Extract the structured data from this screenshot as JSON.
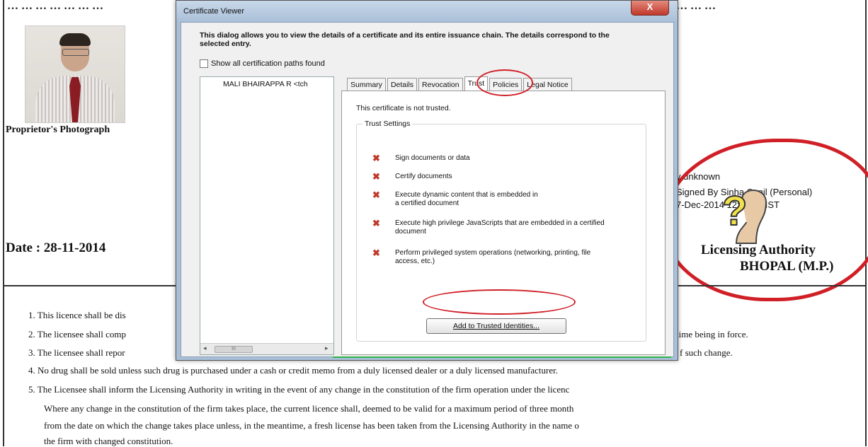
{
  "background_doc": {
    "top_text_left": "… … … … … … …",
    "top_text_right": "… … …",
    "photo_caption": "Proprietor's Photograph",
    "date": "Date : 28-11-2014",
    "signature": {
      "validity": "y unknown",
      "signed_by": "Signed By Sinha Sunil  (Personal)",
      "timestamp": "7-Dec-2014 12:52:05 IST"
    },
    "authority_line1": "Licensing Authority",
    "authority_line2": "BHOPAL (M.P.)",
    "conditions": [
      "1. This licence shall be dis",
      "2. The licensee shall comp",
      "3. The licensee shall repor",
      "4. No drug shall be sold unless such drug is purchased under a cash or credit memo from a duly licensed dealer or a duly licensed manufacturer.",
      "5. The Licensee shall inform the Licensing Authority in writing in the event of any change in the constitution of the firm operation under the licenc"
    ],
    "condition_continuations": [
      "Where any change in the constitution of the firm takes place, the current licence shall, deemed to be valid for a maximum period of three month",
      "from the date on which the change takes place unless, in the meantime, a fresh license has been taken from the Licensing Authority in the name o",
      "the firm with changed constitution."
    ],
    "cond2_tail": "time being in force.",
    "cond3_tail": "f such change.",
    "accent_red": "#d01f26"
  },
  "dialog": {
    "title": "Certificate Viewer",
    "close_label": "X",
    "intro": "This dialog allows you to view the details of a certificate and its entire issuance chain. The details correspond to the selected entry.",
    "show_paths_label": "Show all certification paths found",
    "tree_item": "MALI BHAIRAPPA R <tch",
    "scroll_left": "◂",
    "scroll_thumb": "III",
    "scroll_right": "▸",
    "tabs": [
      "Summary",
      "Details",
      "Revocation",
      "Trust",
      "Policies",
      "Legal Notice"
    ],
    "active_tab": "Trust",
    "trust_status": "This certificate is not trusted.",
    "trust_settings_label": "Trust Settings",
    "permissions": [
      "Sign documents or data",
      "Certify documents",
      "Execute dynamic content that is embedded in a certified document",
      "Execute high privilege JavaScripts that are embedded in a certified document",
      "Perform privileged system operations (networking, printing, file access, etc.)"
    ],
    "deny_glyph": "✖",
    "add_button": "Add to Trusted Identities..."
  }
}
